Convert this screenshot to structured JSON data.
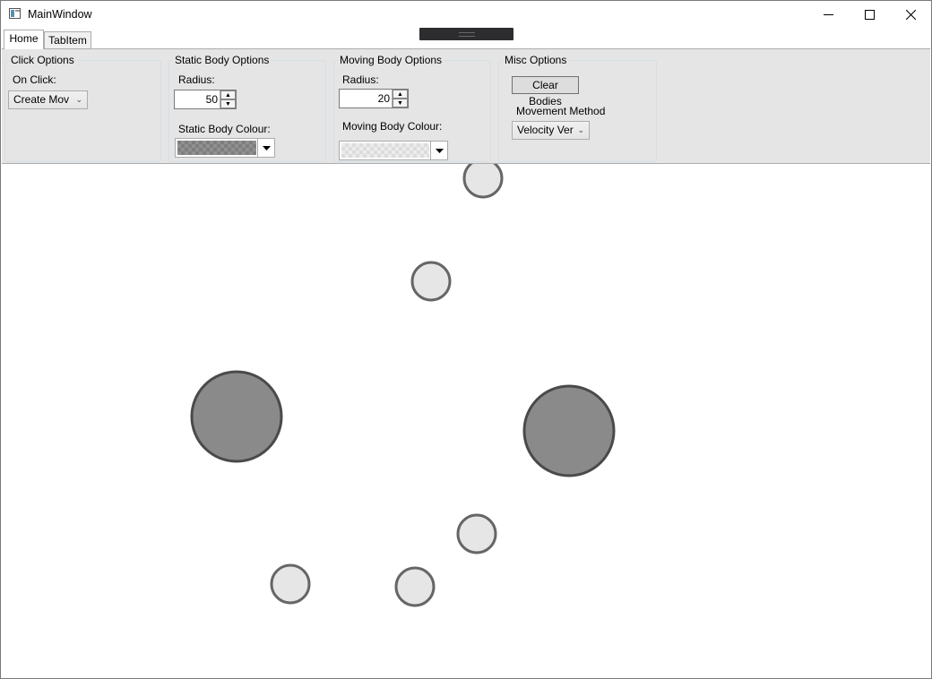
{
  "window": {
    "title": "MainWindow"
  },
  "tabs": [
    {
      "label": "Home",
      "selected": true
    },
    {
      "label": "TabItem",
      "selected": false
    }
  ],
  "click_options": {
    "header": "Click Options",
    "on_click_label": "On Click:",
    "on_click_value": "Create Mov"
  },
  "static_body_options": {
    "header": "Static Body Options",
    "radius_label": "Radius:",
    "radius_value": "50",
    "colour_label": "Static Body Colour:"
  },
  "moving_body_options": {
    "header": "Moving Body Options",
    "radius_label": "Radius:",
    "radius_value": "20",
    "colour_label": "Moving Body Colour:"
  },
  "misc_options": {
    "header": "Misc Options",
    "clear_button": "Clear Bodies",
    "movement_label": "Movement Method",
    "movement_value": "Velocity Ver"
  },
  "colors": {
    "static_fill": "#8a8a8a",
    "static_stroke": "#4a4a4a",
    "moving_fill": "#e6e6e6",
    "moving_stroke": "#666666"
  },
  "bodies": [
    {
      "kind": "moving"
    },
    {
      "kind": "moving"
    },
    {
      "kind": "static"
    },
    {
      "kind": "static"
    },
    {
      "kind": "moving"
    },
    {
      "kind": "moving"
    },
    {
      "kind": "moving"
    }
  ]
}
